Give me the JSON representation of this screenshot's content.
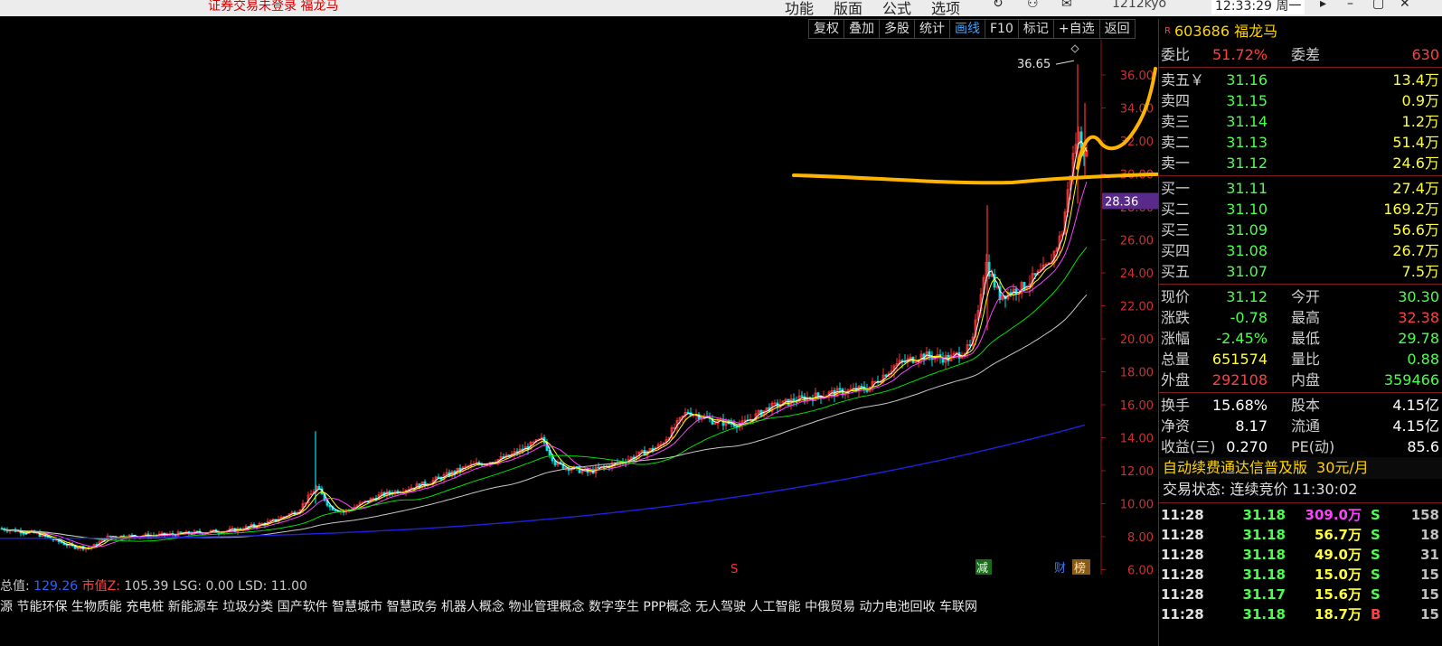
{
  "topbar": {
    "status": "证券交易未登录  福龙马",
    "menu": [
      "功能",
      "版面",
      "公式",
      "选项"
    ],
    "user": "1212kyo",
    "clock": "12:33:29 周一"
  },
  "toolbar": [
    "复权",
    "叠加",
    "多股",
    "统计",
    "画线",
    "F10",
    "标记",
    "+自选",
    "返回"
  ],
  "chart": {
    "peak_label": "36.65",
    "current_price_tag": "28.36",
    "y_ticks": [
      "36.00",
      "34.00",
      "32.00",
      "30.00",
      "28.00",
      "26.00",
      "24.00",
      "22.00",
      "20.00",
      "18.00",
      "16.00",
      "14.00",
      "12.00",
      "10.00",
      "8.00",
      "6.00"
    ],
    "markers": {
      "s": "S",
      "reduce": "减",
      "fin": "财",
      "rank": "榜"
    },
    "colors": {
      "up": "#ff3232",
      "down": "#00e4e4",
      "ma5": "#ffffff",
      "ma10": "#ffff00",
      "ma20": "#ff40ff",
      "ma60": "#00e000",
      "ma120": "#c8c8c8",
      "ma250": "#2020e0",
      "annotation": "#ffb400"
    }
  },
  "info": {
    "total_label": "总值:",
    "total_value": "129.26",
    "mcap_label": "市值Z:",
    "mcap_value": "105.39",
    "lsg": "LSG: 0.00",
    "lsd": "LSD: 11.00",
    "concepts": "源 节能环保 生物质能 充电桩 新能源车 垃圾分类 国产软件 智慧城市 智慧政务 机器人概念 物业管理概念 数字孪生 PPP概念 无人驾驶 人工智能 中俄贸易 动力电池回收 车联网"
  },
  "quote": {
    "code": "603686",
    "name": "福龙马",
    "webi_label": "委比",
    "webi": "51.72%",
    "wecha_label": "委差",
    "wecha": "630",
    "asks": [
      {
        "label": "卖五￥",
        "price": "31.16",
        "vol": "13.4万"
      },
      {
        "label": "卖四",
        "price": "31.15",
        "vol": "0.9万"
      },
      {
        "label": "卖三",
        "price": "31.14",
        "vol": "1.2万"
      },
      {
        "label": "卖二",
        "price": "31.13",
        "vol": "51.4万"
      },
      {
        "label": "卖一",
        "price": "31.12",
        "vol": "24.6万"
      }
    ],
    "bids": [
      {
        "label": "买一",
        "price": "31.11",
        "vol": "27.4万"
      },
      {
        "label": "买二",
        "price": "31.10",
        "vol": "169.2万"
      },
      {
        "label": "买三",
        "price": "31.09",
        "vol": "56.6万"
      },
      {
        "label": "买四",
        "price": "31.08",
        "vol": "26.7万"
      },
      {
        "label": "买五",
        "price": "31.07",
        "vol": "7.5万"
      }
    ],
    "stats": [
      {
        "l1": "现价",
        "v1": "31.12",
        "c1": "green",
        "l2": "今开",
        "v2": "30.30",
        "c2": "green"
      },
      {
        "l1": "涨跌",
        "v1": "-0.78",
        "c1": "green",
        "l2": "最高",
        "v2": "32.38",
        "c2": "red"
      },
      {
        "l1": "涨幅",
        "v1": "-2.45%",
        "c1": "green",
        "l2": "最低",
        "v2": "29.78",
        "c2": "green"
      },
      {
        "l1": "总量",
        "v1": "651574",
        "c1": "yellow",
        "l2": "量比",
        "v2": "0.88",
        "c2": "green"
      },
      {
        "l1": "外盘",
        "v1": "292108",
        "c1": "red",
        "l2": "内盘",
        "v2": "359466",
        "c2": "green"
      }
    ],
    "fund": [
      {
        "l1": "换手",
        "v1": "15.68%",
        "l2": "股本",
        "v2": "4.15亿"
      },
      {
        "l1": "净资",
        "v1": "8.17",
        "l2": "流通",
        "v2": "4.15亿"
      },
      {
        "l1": "收益(三)",
        "v1": "0.270",
        "l2": "PE(动)",
        "v2": "85.6"
      }
    ],
    "promo": "自动续费通达信普及版",
    "promo_fee": "30元/月",
    "state": "交易状态: 连续竞价 11:30:02",
    "ticks": [
      {
        "time": "11:28",
        "price": "31.18",
        "vol": "309.0万",
        "vol_color": "magenta",
        "dir": "S",
        "dir_color": "green",
        "num": "158"
      },
      {
        "time": "11:28",
        "price": "31.18",
        "vol": "56.7万",
        "vol_color": "yellow",
        "dir": "S",
        "dir_color": "green",
        "num": "18"
      },
      {
        "time": "11:28",
        "price": "31.18",
        "vol": "49.0万",
        "vol_color": "yellow",
        "dir": "S",
        "dir_color": "green",
        "num": "31"
      },
      {
        "time": "11:28",
        "price": "31.18",
        "vol": "15.0万",
        "vol_color": "yellow",
        "dir": "S",
        "dir_color": "green",
        "num": "15"
      },
      {
        "time": "11:28",
        "price": "31.17",
        "vol": "15.6万",
        "vol_color": "yellow",
        "dir": "S",
        "dir_color": "green",
        "num": "15"
      },
      {
        "time": "11:28",
        "price": "31.18",
        "vol": "18.7万",
        "vol_color": "yellow",
        "dir": "B",
        "dir_color": "red",
        "num": "15"
      }
    ]
  }
}
